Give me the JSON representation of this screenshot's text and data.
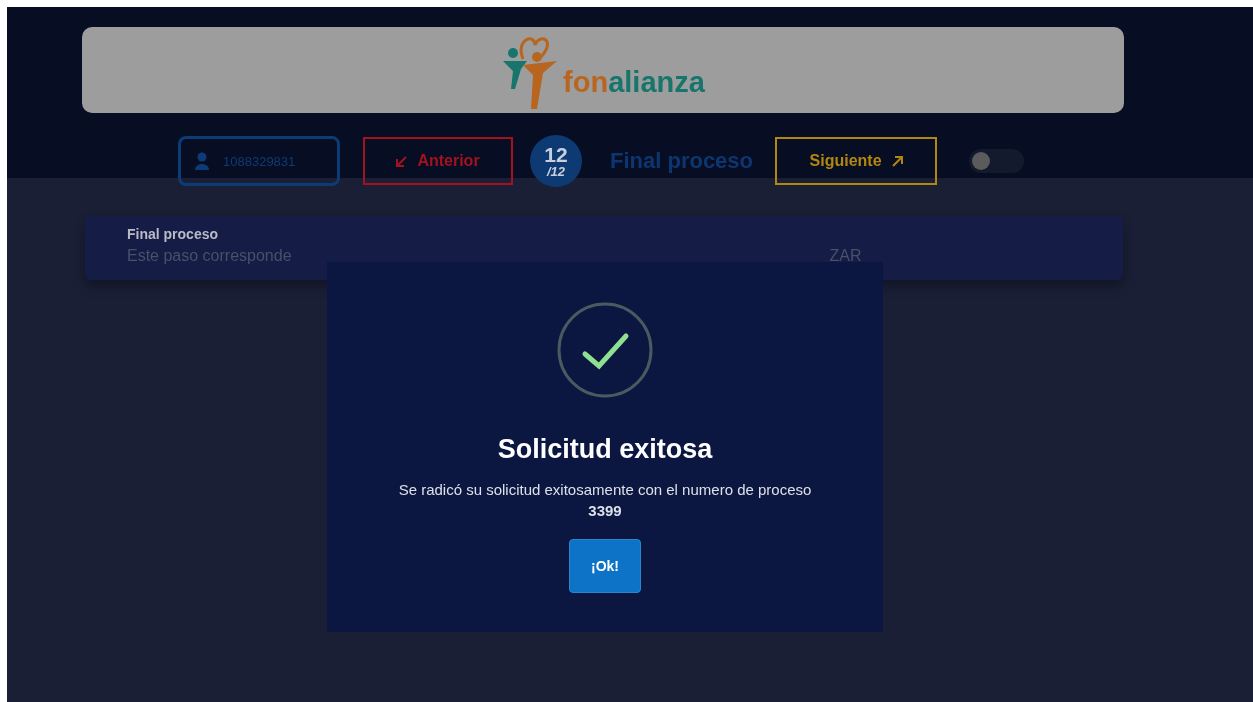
{
  "header": {
    "logo_parts": [
      {
        "text": "fon",
        "color": "#b8661f"
      },
      {
        "text": "alianza",
        "color": "#17756c"
      }
    ]
  },
  "toolbar": {
    "user_id": "1088329831",
    "prev_button": "Anterior",
    "step": "12",
    "step_total": "/12",
    "step_title": "Final proceso",
    "next_button": "Siguiente",
    "toggle": {
      "on": false
    }
  },
  "card": {
    "title": "Final proceso",
    "text": "Este paso corresponde",
    "text_tail": "ZAR"
  },
  "dialog": {
    "title": "Solicitud exitosa",
    "message": "Se radicó su solicitud exitosamente con el numero de proceso **3399**",
    "button": "¡Ok!"
  }
}
